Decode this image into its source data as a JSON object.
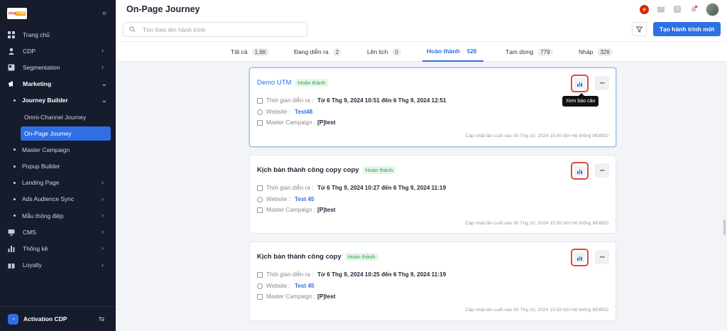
{
  "sidebar": {
    "logo_text_a": "plag",
    "logo_text_b": "COM",
    "collapse_icon": "«",
    "items": [
      {
        "label": "Trang chủ"
      },
      {
        "label": "CDP"
      },
      {
        "label": "Segmentation"
      },
      {
        "label": "Marketing"
      },
      {
        "label": "Journey Builder"
      },
      {
        "label": "Omni-Channel Journey"
      },
      {
        "label": "On-Page Journey"
      },
      {
        "label": "Master Campaign"
      },
      {
        "label": "Popup Builder"
      },
      {
        "label": "Landing Page"
      },
      {
        "label": "Ads Audience Sync"
      },
      {
        "label": "Mẫu thông điệp"
      },
      {
        "label": "CMS"
      },
      {
        "label": "Thống kê"
      },
      {
        "label": "Loyalty"
      }
    ],
    "bottom": {
      "label": "Activation CDP",
      "switch_icon": "⇆"
    }
  },
  "header": {
    "title": "On-Page Journey",
    "search_placeholder": "Tìm theo tên hành trình",
    "create_label": "Tạo hành trình mới"
  },
  "tabs": [
    {
      "label": "Tất cả",
      "count": "1,6K"
    },
    {
      "label": "Đang diễn ra",
      "count": "2"
    },
    {
      "label": "Lên lịch",
      "count": "0"
    },
    {
      "label": "Hoàn thành",
      "count": "528"
    },
    {
      "label": "Tạm dừng",
      "count": "779"
    },
    {
      "label": "Nháp",
      "count": "326"
    }
  ],
  "cards": [
    {
      "title": "Demo UTM",
      "status": "Hoàn thành",
      "time_label": "Thời gian diễn ra :",
      "time_value": "Từ 6 Thg 9, 2024 10:51 đến 6 Thg 9, 2024 12:51",
      "website_label": "Website :",
      "website_value": "Test48",
      "campaign_label": "Master Campaign :",
      "campaign_value": "[P]test",
      "updated": "Cập nhật lần cuối vào 30 Thg 10, 2024 15:50 bởi Hệ thống MOBIO"
    },
    {
      "title": "Kịch bản thành công copy copy",
      "status": "Hoàn thành",
      "time_label": "Thời gian diễn ra :",
      "time_value": "Từ 6 Thg 9, 2024 10:27 đến 6 Thg 9, 2024 11:19",
      "website_label": "Website :",
      "website_value": "Test 45",
      "campaign_label": "Master Campaign :",
      "campaign_value": "[P]test",
      "updated": "Cập nhật lần cuối vào 30 Thg 10, 2024 15:50 bởi Hệ thống MOBIO"
    },
    {
      "title": "Kịch bản thành công copy",
      "status": "Hoàn thành",
      "time_label": "Thời gian diễn ra :",
      "time_value": "Từ 6 Thg 9, 2024 10:25 đến 6 Thg 9, 2024 11:19",
      "website_label": "Website :",
      "website_value": "Test 45",
      "campaign_label": "Master Campaign :",
      "campaign_value": "[P]test",
      "updated": "Cập nhật lần cuối vào 30 Thg 10, 2024 15:50 bởi Hệ thống MOBIO"
    }
  ],
  "tooltip": "Xem báo cáo",
  "more_icon": "···",
  "colors": {
    "accent": "#2f6fe4",
    "sidebar_bg": "#161c2c",
    "report_outline": "#e5483d",
    "status_green": "#2aa14a"
  }
}
